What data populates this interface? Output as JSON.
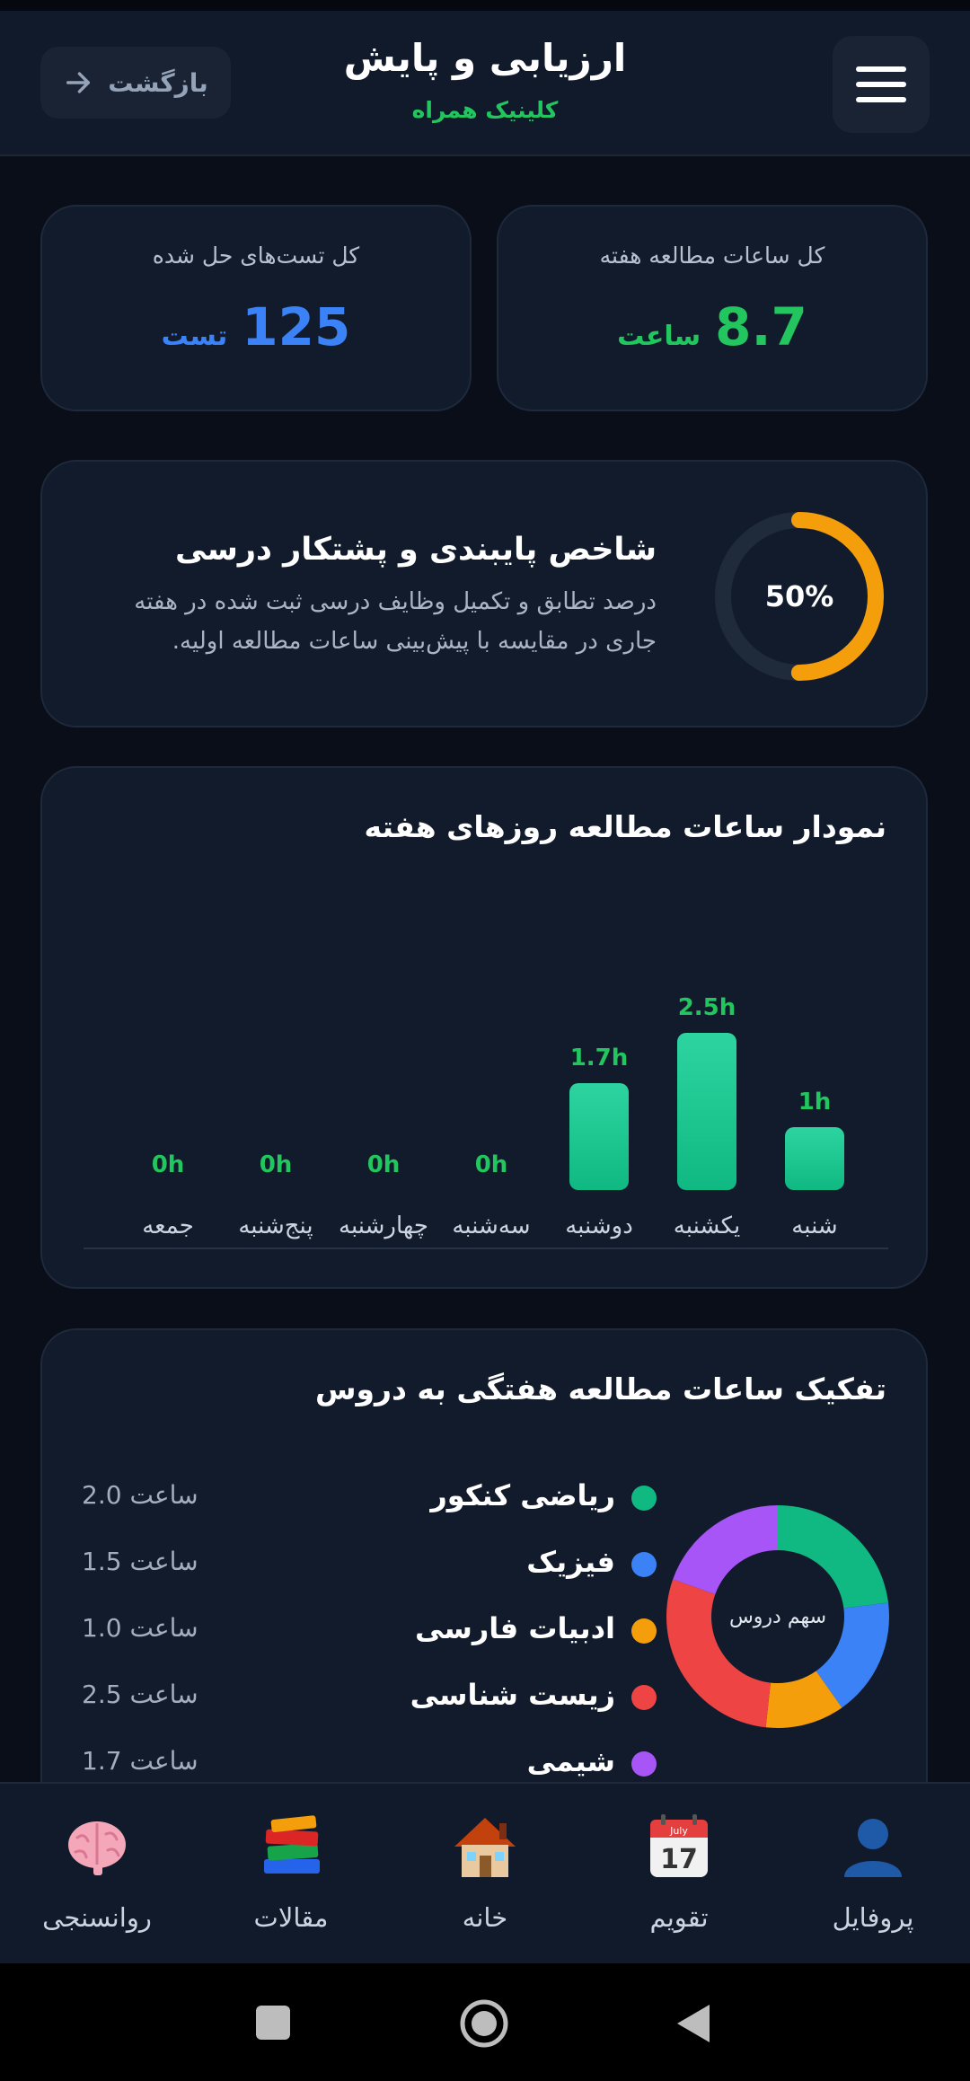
{
  "header": {
    "back_label": "بازگشت",
    "title": "ارزیابی و پایش",
    "subtitle": "کلینیک همراه"
  },
  "stats": {
    "tests_label": "کل تست‌های حل شده",
    "tests_value": "125",
    "tests_unit": "تست",
    "hours_label": "کل ساعات مطالعه هفته",
    "hours_value": "8.7",
    "hours_unit": "ساعت"
  },
  "adherence": {
    "percent": 50,
    "percent_label": "50%",
    "title": "شاخص پایبندی و پشتکار درسی",
    "description": "درصد تطابق و تکمیل وظایف درسی ثبت شده در هفته جاری در مقایسه با پیش‌بینی ساعات مطالعه اولیه."
  },
  "weekly_chart": {
    "title": "نمودار ساعات مطالعه روزهای هفته"
  },
  "subjects": {
    "title": "تفکیک ساعات مطالعه هفتگی به دروس",
    "center_label": "سهم دروس",
    "items": [
      {
        "name": "ریاضی کنکور",
        "value": "2.0 ساعت",
        "color": "#10b981"
      },
      {
        "name": "فیزیک",
        "value": "1.5 ساعت",
        "color": "#3b82f6"
      },
      {
        "name": "ادبیات فارسی",
        "value": "1.0 ساعت",
        "color": "#f59e0b"
      },
      {
        "name": "زیست شناسی",
        "value": "2.5 ساعت",
        "color": "#ef4444"
      },
      {
        "name": "شیمی",
        "value": "1.7 ساعت",
        "color": "#a855f7"
      }
    ]
  },
  "chart_data": [
    {
      "type": "bar",
      "categories": [
        "شنبه",
        "یکشنبه",
        "دوشنبه",
        "سه‌شنبه",
        "چهارشنبه",
        "پنج‌شنبه",
        "جمعه"
      ],
      "values": [
        1,
        2.5,
        1.7,
        0,
        0,
        0,
        0
      ],
      "value_labels": [
        "1h",
        "2.5h",
        "1.7h",
        "0h",
        "0h",
        "0h",
        "0h"
      ],
      "ylim": [
        0,
        2.5
      ],
      "color": "#22c55e"
    },
    {
      "type": "pie",
      "categories": [
        "ریاضی کنکور",
        "فیزیک",
        "ادبیات فارسی",
        "زیست شناسی",
        "شیمی"
      ],
      "values": [
        2.0,
        1.5,
        1.0,
        2.5,
        1.7
      ],
      "colors": [
        "#10b981",
        "#3b82f6",
        "#f59e0b",
        "#ef4444",
        "#a855f7"
      ]
    }
  ],
  "nav": {
    "items": [
      {
        "label": "پروفایل",
        "icon": "profile-icon"
      },
      {
        "label": "تقویم",
        "icon": "calendar-icon",
        "calendar_month": "July",
        "calendar_day": "17"
      },
      {
        "label": "خانه",
        "icon": "home-icon"
      },
      {
        "label": "مقالات",
        "icon": "books-icon"
      },
      {
        "label": "روانسنجی",
        "icon": "brain-icon"
      }
    ]
  },
  "colors": {
    "background": "#090e18",
    "card": "#121b2c",
    "accent_green": "#22c55e",
    "accent_blue": "#3b82f6",
    "accent_amber": "#f59e0b"
  }
}
